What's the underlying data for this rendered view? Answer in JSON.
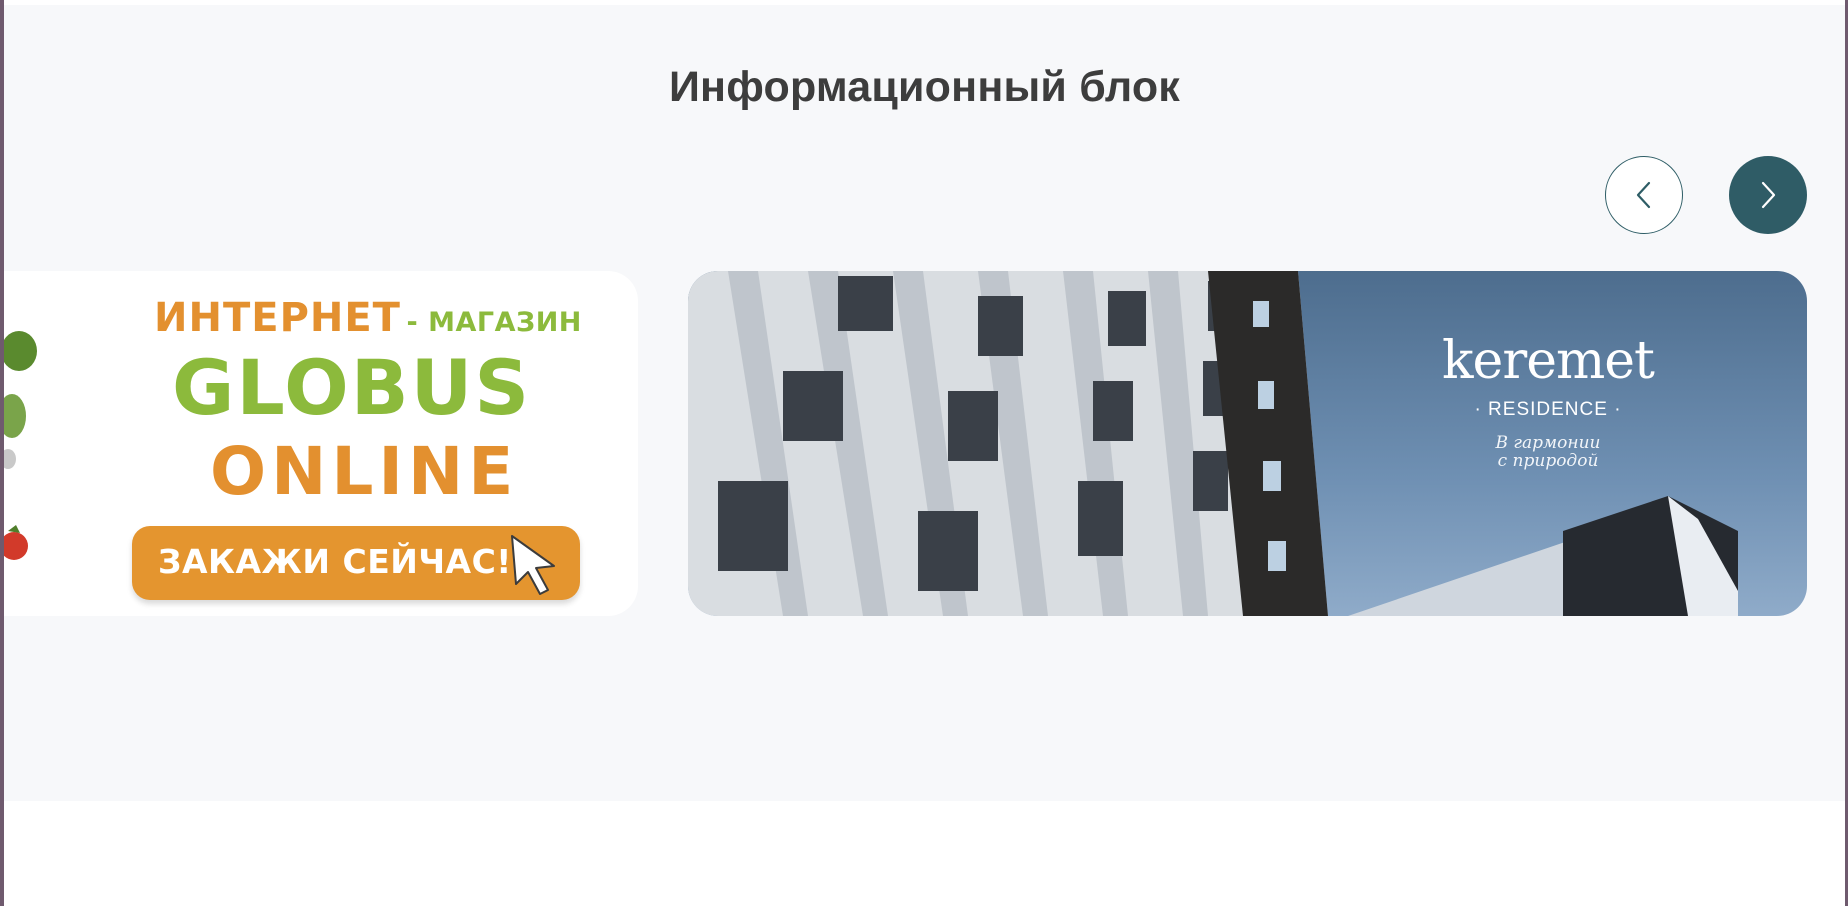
{
  "section": {
    "title": "Информационный блок"
  },
  "slider": {
    "prev_icon": "chevron-left-icon",
    "next_icon": "chevron-right-icon",
    "colors": {
      "accent": "#2f5c66",
      "background": "#f7f8fa"
    },
    "slides": [
      {
        "line1_a": "ИНТЕРНЕТ",
        "line1_b": "- МАГАЗИН",
        "line2": "GLOBUS",
        "line3": "ONLINE",
        "cta": "ЗАКАЖИ СЕЙЧАС!",
        "colors": {
          "orange": "#e3902f",
          "green": "#8cba3c"
        }
      },
      {
        "brand": "keremet",
        "sub": "· RESIDENCE ·",
        "tagline_1": "В гармонии",
        "tagline_2": "с природой"
      }
    ]
  }
}
